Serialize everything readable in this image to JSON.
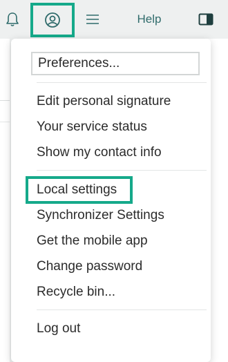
{
  "toolbar": {
    "notifications_icon": "bell-icon",
    "account_icon": "user-circle-icon",
    "menu_icon": "hamburger-icon",
    "help_label": "Help",
    "panel_icon": "side-panel-icon",
    "accent_color": "#15a98a"
  },
  "menu": {
    "preferences": "Preferences...",
    "group1": [
      "Edit personal signature",
      "Your service status",
      "Show my contact info"
    ],
    "local_settings": "Local settings",
    "group2": [
      "Synchronizer Settings",
      "Get the mobile app",
      "Change password",
      "Recycle bin..."
    ],
    "logout": "Log out"
  }
}
